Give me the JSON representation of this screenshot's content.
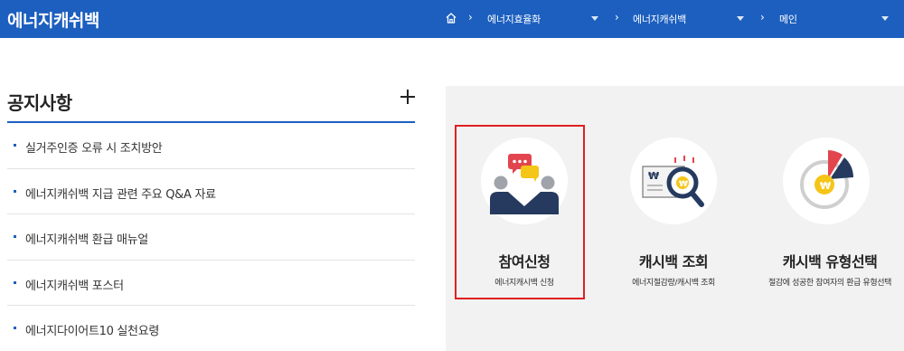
{
  "header": {
    "site_title": "에너지캐쉬백",
    "breadcrumb": [
      "에너지효율화",
      "에너지캐쉬백",
      "메인"
    ],
    "home_icon": "home-icon",
    "colors": {
      "bar": "#1c5fbf",
      "text": "#ffffff"
    }
  },
  "notice": {
    "title": "공지사항",
    "more_icon": "plus-icon",
    "items": [
      "실거주인증 오류 시 조치방안",
      "에너지캐쉬백 지급 관련 주요 Q&A 자료",
      "에너지캐쉬백 환급 매뉴얼",
      "에너지캐쉬백 포스터",
      "에너지다이어트10 실천요령"
    ]
  },
  "services": [
    {
      "title": "참여신청",
      "subtitle": "에너지캐시백 신청",
      "icon": "people-chat-icon",
      "highlighted": true
    },
    {
      "title": "캐시백 조회",
      "subtitle": "에너지절감량/캐시백 조회",
      "icon": "won-magnifier-icon",
      "highlighted": false
    },
    {
      "title": "캐시백 유형선택",
      "subtitle": "절감에 성공한 참여자의 환급 유형선택",
      "icon": "won-pie-chart-icon",
      "highlighted": false
    }
  ],
  "colors": {
    "highlight_border": "#e02020",
    "panel_bg": "#f2f2f2",
    "icon_navy": "#253a5e",
    "icon_red": "#e2454d",
    "icon_yellow": "#f5c518"
  }
}
